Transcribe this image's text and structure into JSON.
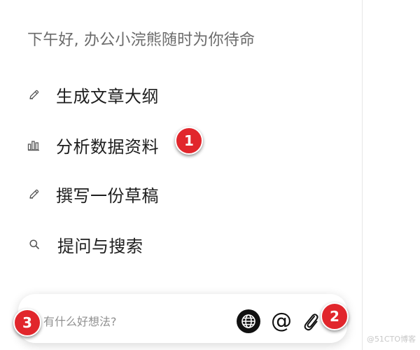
{
  "greeting": "下午好, 办公小浣熊随时为你待命",
  "suggestions": [
    {
      "label": "生成文章大纲",
      "icon": "pencil-icon"
    },
    {
      "label": "分析数据资料",
      "icon": "bar-chart-icon"
    },
    {
      "label": "撰写一份草稿",
      "icon": "pencil-icon"
    },
    {
      "label": "提问与搜索",
      "icon": "search-icon"
    }
  ],
  "input": {
    "placeholder": "有什么好想法?",
    "value": ""
  },
  "toolbar": {
    "web_search_icon": "globe-icon",
    "mention_label": "@",
    "attach_icon": "paperclip-icon"
  },
  "badges": [
    "1",
    "2",
    "3"
  ],
  "watermark": "@51CTO博客",
  "colors": {
    "badge": "#e1262c",
    "text": "#1d1d1d",
    "greeting": "#6a6a6a",
    "placeholder": "#8f8f8f"
  }
}
